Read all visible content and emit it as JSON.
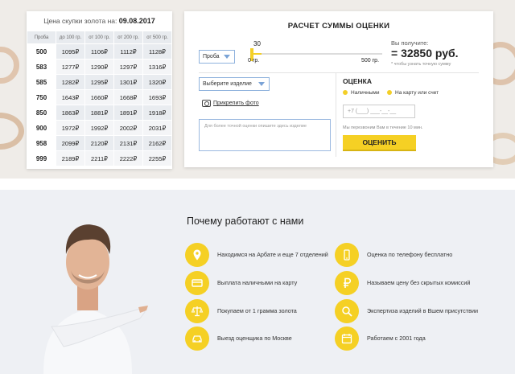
{
  "price_table": {
    "heading_prefix": "Цена скупки золота на:",
    "date": "09.08.2017",
    "columns": [
      "Проба",
      "до 100 гр.",
      "от 100 гр.",
      "от 200 гр.",
      "от 500 гр."
    ],
    "rows": [
      [
        "500",
        "1095₽",
        "1106₽",
        "1112₽",
        "1128₽"
      ],
      [
        "583",
        "1277₽",
        "1290₽",
        "1297₽",
        "1316₽"
      ],
      [
        "585",
        "1282₽",
        "1295₽",
        "1301₽",
        "1320₽"
      ],
      [
        "750",
        "1643₽",
        "1660₽",
        "1668₽",
        "1693₽"
      ],
      [
        "850",
        "1863₽",
        "1881₽",
        "1891₽",
        "1918₽"
      ],
      [
        "900",
        "1972₽",
        "1992₽",
        "2002₽",
        "2031₽"
      ],
      [
        "958",
        "2099₽",
        "2120₽",
        "2131₽",
        "2162₽"
      ],
      [
        "999",
        "2189₽",
        "2211₽",
        "2222₽",
        "2255₽"
      ]
    ]
  },
  "calculator": {
    "title": "РАСЧЕТ СУММЫ ОЦЕНКИ",
    "probe_select": "Проба",
    "slider_value": "30",
    "slider_min": "0 гр.",
    "slider_max": "500 гр.",
    "slider_fraction": 0.06,
    "you_get_label": "Вы получите:",
    "sum": "= 32850 руб.",
    "sum_note": "* чтобы узнать точную сумму",
    "item_select": "Выберите изделие",
    "photo_link": "Прикрепить фото",
    "textarea_placeholder": "Для более точной оценки опишите здесь изделие",
    "estimate_title": "ОЦЕНКА",
    "radio_cash": "Наличными",
    "radio_card": "На карту или счет",
    "phone_placeholder": "+7 (___) ___-__-__",
    "callback_note": "Мы перезвоним Вам в течение 10 мин.",
    "submit_label": "ОЦЕНИТЬ"
  },
  "why": {
    "title": "Почему работают с нами",
    "features_left": [
      {
        "icon": "location-pin-icon",
        "text": "Находимся на Арбате и еще 7 отделений"
      },
      {
        "icon": "credit-card-icon",
        "text": "Выплата наличными на карту"
      },
      {
        "icon": "scales-icon",
        "text": "Покупаем от 1 грамма золота"
      },
      {
        "icon": "car-icon",
        "text": "Выезд оценщика по Москве"
      }
    ],
    "features_right": [
      {
        "icon": "smartphone-icon",
        "text": "Оценка по телефону бесплатно"
      },
      {
        "icon": "ruble-icon",
        "text": "Называем цену без скрытых комиссий"
      },
      {
        "icon": "magnifier-icon",
        "text": "Экспертиза изделий в Вшем присутствии"
      },
      {
        "icon": "calendar-icon",
        "text": "Работаем с 2001 года"
      }
    ]
  },
  "colors": {
    "accent": "#f5d024",
    "input_border": "#8fb2dd",
    "section_bg": "#eef0f4"
  }
}
